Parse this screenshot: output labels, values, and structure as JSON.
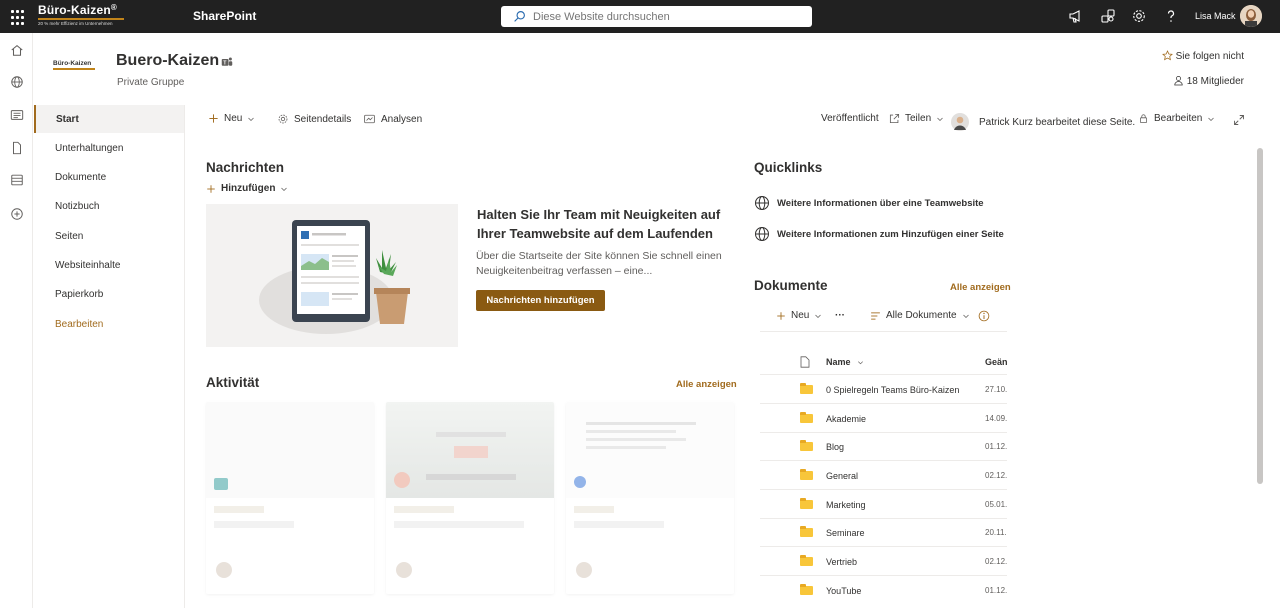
{
  "suite": {
    "brand": "Büro-Kaizen",
    "brand_mark": "®",
    "brand_tagline": "20 % mehr Effizienz im Unternehmen",
    "app_name": "SharePoint",
    "search_placeholder": "Diese Website durchsuchen",
    "user_name": "Lisa Mack"
  },
  "site": {
    "logo_text": "Büro-Kaizen",
    "title": "Buero-Kaizen",
    "subtitle": "Private Gruppe",
    "follow_label": "Sie folgen nicht",
    "members_label": "18 Mitglieder"
  },
  "nav": {
    "items": [
      {
        "label": "Start"
      },
      {
        "label": "Unterhaltungen"
      },
      {
        "label": "Dokumente"
      },
      {
        "label": "Notizbuch"
      },
      {
        "label": "Seiten"
      },
      {
        "label": "Websiteinhalte"
      },
      {
        "label": "Papierkorb"
      },
      {
        "label": "Bearbeiten"
      }
    ]
  },
  "commandbar": {
    "new_label": "Neu",
    "page_details_label": "Seitendetails",
    "analytics_label": "Analysen",
    "published_label": "Veröffentlicht",
    "share_label": "Teilen",
    "editing_status": "Patrick Kurz bearbeitet diese Seite.",
    "edit_label": "Bearbeiten"
  },
  "news": {
    "title": "Nachrichten",
    "add_label": "Hinzufügen",
    "headline": "Halten Sie Ihr Team mit Neuigkeiten auf Ihrer Teamwebsite auf dem Laufenden",
    "body": "Über die Startseite der Site können Sie schnell einen Neuigkeitenbeitrag verfassen – eine...",
    "button_label": "Nachrichten hinzufügen"
  },
  "activity": {
    "title": "Aktivität",
    "see_all_label": "Alle anzeigen"
  },
  "quicklinks": {
    "title": "Quicklinks",
    "links": [
      {
        "label": "Weitere Informationen über eine Teamwebsite"
      },
      {
        "label": "Weitere Informationen zum Hinzufügen einer Seite"
      }
    ]
  },
  "documents": {
    "title": "Dokumente",
    "see_all_label": "Alle anzeigen",
    "new_label": "Neu",
    "more_label": "···",
    "view_label": "Alle Dokumente",
    "col_name": "Name",
    "col_modified": "Geän",
    "rows": [
      {
        "name": "0 Spielregeln Teams Büro-Kaizen",
        "date": "27.10."
      },
      {
        "name": "Akademie",
        "date": "14.09."
      },
      {
        "name": "Blog",
        "date": "01.12."
      },
      {
        "name": "General",
        "date": "02.12."
      },
      {
        "name": "Marketing",
        "date": "05.01."
      },
      {
        "name": "Seminare",
        "date": "20.11."
      },
      {
        "name": "Vertrieb",
        "date": "02.12."
      },
      {
        "name": "YouTube",
        "date": "01.12."
      }
    ]
  },
  "colors": {
    "accent": "#a16b1e",
    "button": "#8a5a12",
    "suitebar": "#212121",
    "folder": "#f8c63a"
  }
}
